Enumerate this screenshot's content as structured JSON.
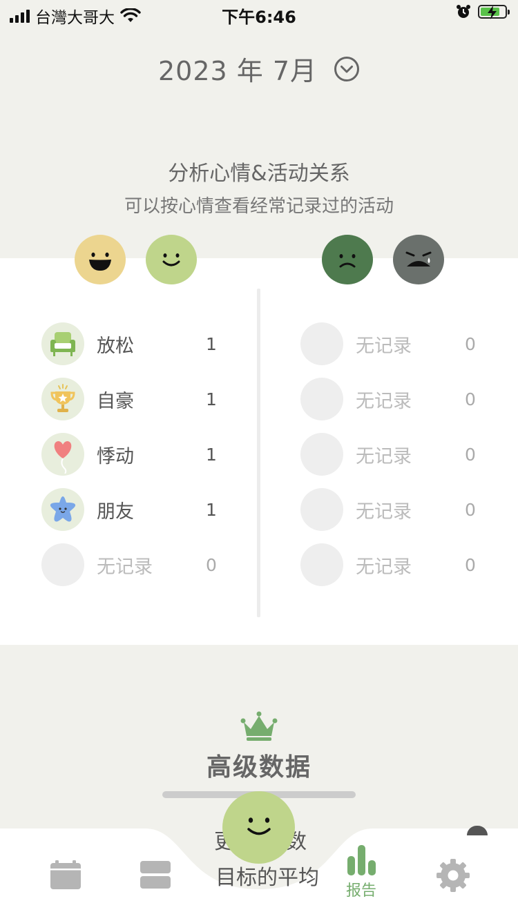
{
  "status_bar": {
    "carrier": "台灣大哥大",
    "time": "下午6:46"
  },
  "header": {
    "month_title": "2023 年 7月"
  },
  "analysis": {
    "title": "分析心情&活动关系",
    "subtitle": "可以按心情查看经常记录过的活动"
  },
  "moods": [
    {
      "name": "very-happy",
      "color": "#ecd58f"
    },
    {
      "name": "happy",
      "color": "#bfd58b"
    },
    {
      "name": "sad",
      "color": "#4e7a4e"
    },
    {
      "name": "very-sad",
      "color": "#6a706c"
    }
  ],
  "left_activities": [
    {
      "label": "放松",
      "count": "1",
      "icon": "sofa-icon"
    },
    {
      "label": "自豪",
      "count": "1",
      "icon": "trophy-icon"
    },
    {
      "label": "悸动",
      "count": "1",
      "icon": "heart-balloon-icon"
    },
    {
      "label": "朋友",
      "count": "1",
      "icon": "star-icon"
    },
    {
      "label": "无记录",
      "count": "0",
      "icon": "empty-icon"
    }
  ],
  "right_activities": [
    {
      "label": "无记录",
      "count": "0",
      "icon": "empty-icon"
    },
    {
      "label": "无记录",
      "count": "0",
      "icon": "empty-icon"
    },
    {
      "label": "无记录",
      "count": "0",
      "icon": "empty-icon"
    },
    {
      "label": "无记录",
      "count": "0",
      "icon": "empty-icon"
    },
    {
      "label": "无记录",
      "count": "0",
      "icon": "empty-icon"
    }
  ],
  "premium": {
    "title": "高级数据",
    "peek_line1_left": "更",
    "peek_line1_right": "数",
    "peek_line2": "目标的平均"
  },
  "tabbar": {
    "tabs": [
      {
        "name": "calendar",
        "label": ""
      },
      {
        "name": "timeline",
        "label": ""
      },
      {
        "name": "report",
        "label": "报告"
      },
      {
        "name": "settings",
        "label": ""
      }
    ],
    "active_color": "#76ad6e",
    "inactive_color": "#b5b5b5"
  }
}
